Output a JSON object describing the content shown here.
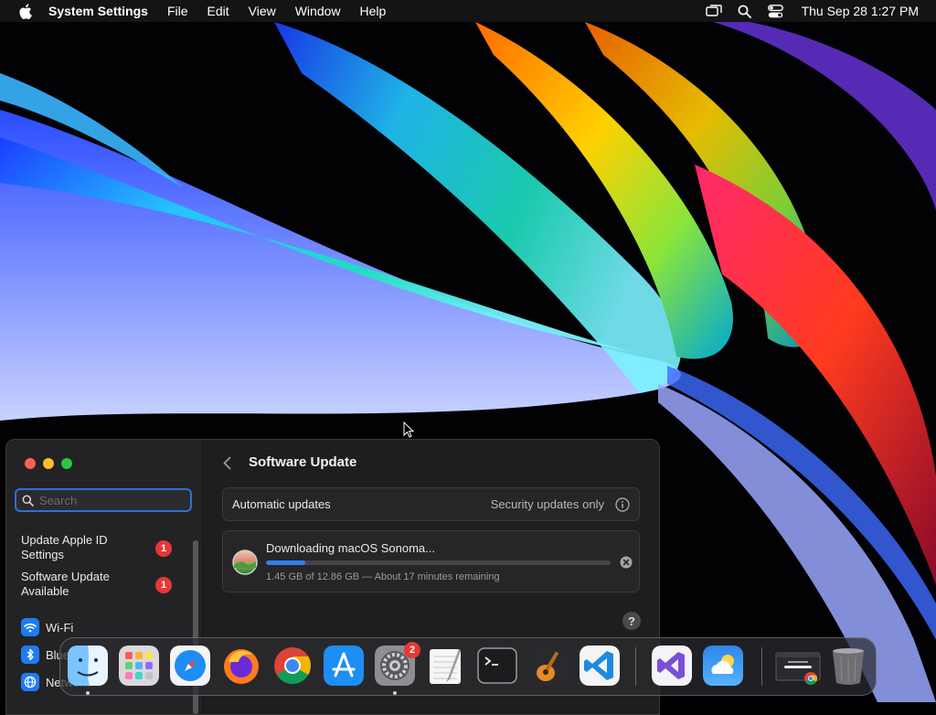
{
  "menubar": {
    "app_name": "System Settings",
    "menus": [
      "File",
      "Edit",
      "View",
      "Window",
      "Help"
    ],
    "clock": "Thu Sep 28  1:27 PM"
  },
  "sidebar": {
    "search_placeholder": "Search",
    "notices": [
      {
        "label": "Update Apple ID Settings",
        "badge": "1"
      },
      {
        "label": "Software Update Available",
        "badge": "1"
      }
    ],
    "items": [
      {
        "label": "Wi-Fi",
        "icon": "wifi-icon"
      },
      {
        "label": "Bluetooth",
        "icon": "bluetooth-icon"
      },
      {
        "label": "Network",
        "icon": "network-icon"
      }
    ]
  },
  "content": {
    "title": "Software Update",
    "automatic_updates": {
      "label": "Automatic updates",
      "value": "Security updates only"
    },
    "download": {
      "title": "Downloading macOS Sonoma...",
      "progress": 0.113,
      "status": "1.45 GB of 12.86 GB — About 17 minutes remaining"
    },
    "help": "?"
  },
  "dock": {
    "apps": [
      {
        "name": "Finder",
        "icon": "finder-icon",
        "running": true
      },
      {
        "name": "Launchpad",
        "icon": "launchpad-icon",
        "running": false
      },
      {
        "name": "Safari",
        "icon": "safari-icon",
        "running": false
      },
      {
        "name": "Firefox",
        "icon": "firefox-icon",
        "running": false
      },
      {
        "name": "Google Chrome",
        "icon": "chrome-icon",
        "running": false
      },
      {
        "name": "App Store",
        "icon": "app-store-icon",
        "running": false
      },
      {
        "name": "System Settings",
        "icon": "system-settings-icon",
        "running": true,
        "badge": "2"
      },
      {
        "name": "TextEdit",
        "icon": "textedit-icon",
        "running": false
      },
      {
        "name": "Terminal",
        "icon": "terminal-icon",
        "running": false
      },
      {
        "name": "GarageBand",
        "icon": "garageband-icon",
        "running": false
      },
      {
        "name": "Visual Studio Code",
        "icon": "vscode-icon",
        "running": false
      },
      {
        "name": "Visual Studio",
        "icon": "visual-studio-icon",
        "running": false
      },
      {
        "name": "Weather",
        "icon": "weather-icon",
        "running": false
      },
      {
        "name": "Chrome Window",
        "icon": "chrome-window-icon",
        "running": false
      },
      {
        "name": "Trash",
        "icon": "trash-icon",
        "running": false
      }
    ]
  },
  "colors": {
    "accent": "#2f7ff0",
    "badge": "#e53935"
  }
}
